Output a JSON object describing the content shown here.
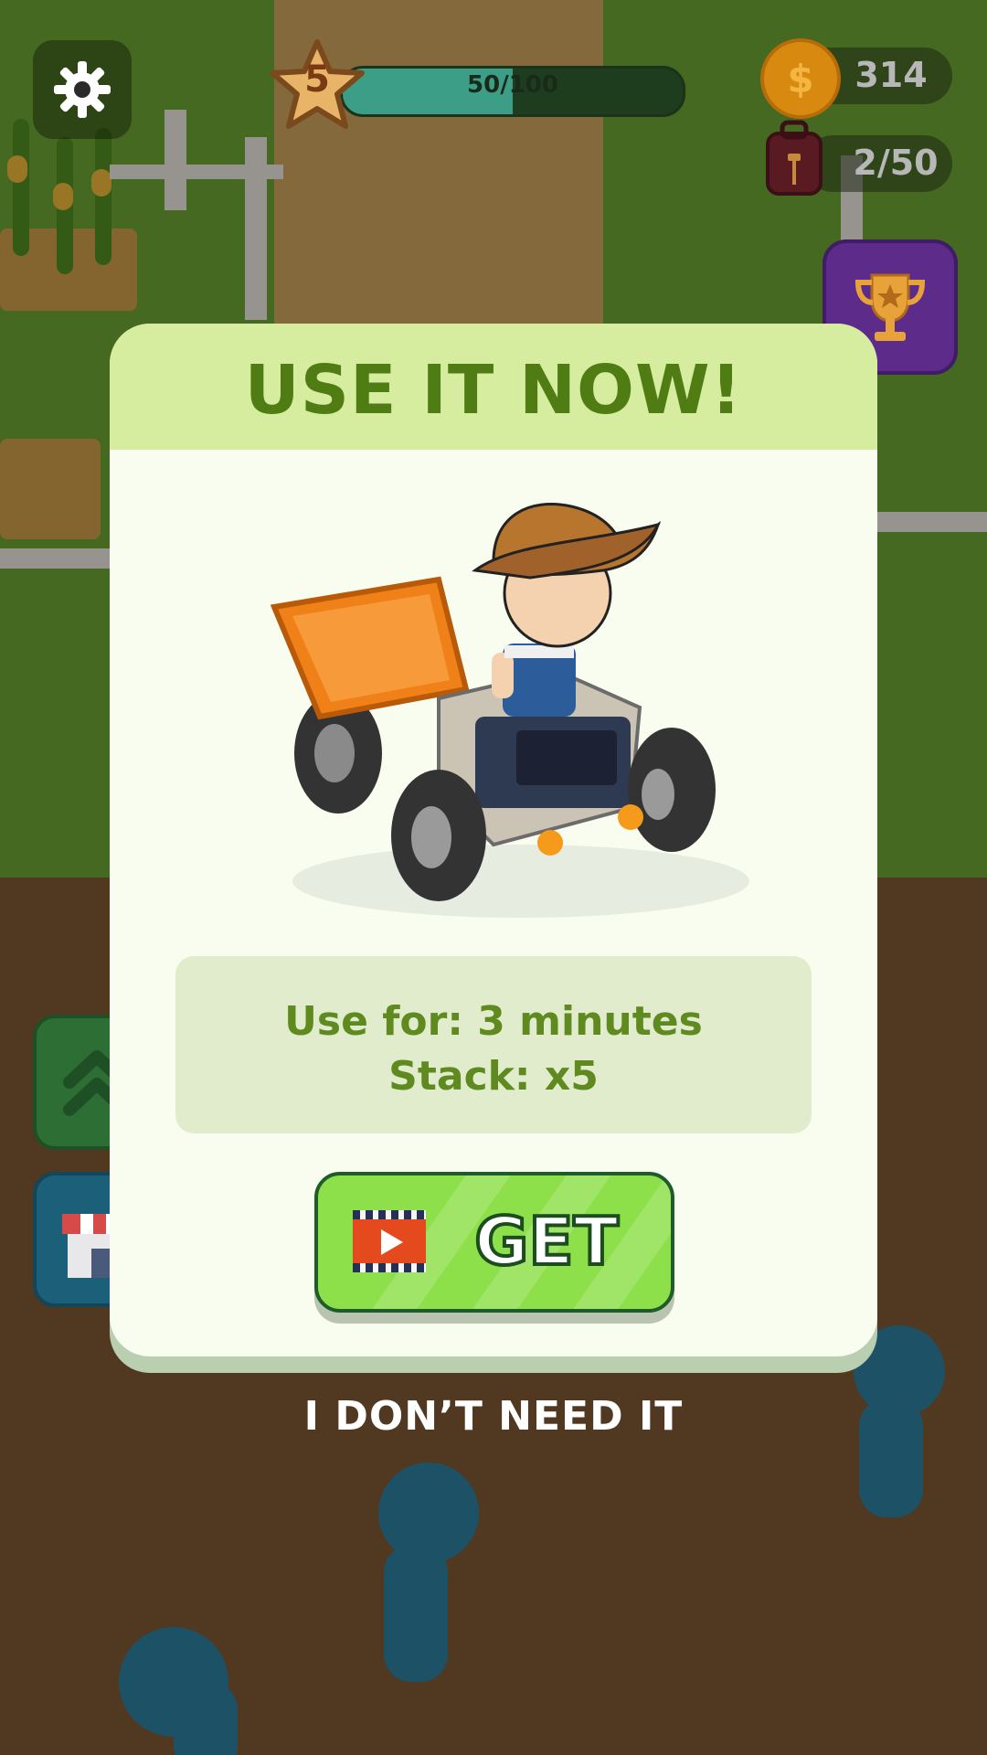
{
  "hud": {
    "level": "5",
    "xp_text": "50/100",
    "xp_progress": 0.5,
    "coins": "314",
    "bag_capacity": "2/50",
    "coin_symbol": "$"
  },
  "modal": {
    "title": "USE IT NOW!",
    "duration_text": "Use for: 3 minutes",
    "stack_text": "Stack: x5",
    "get_label": "GET",
    "decline_label": "I DON’T NEED IT"
  },
  "icons": {
    "settings": "gear-icon",
    "coin": "coin-icon",
    "bag": "backpack-icon",
    "trophy": "trophy-icon",
    "upgrade": "double-chevron-up-icon",
    "shop": "shop-icon",
    "video": "video-ad-icon",
    "vehicle": "farm-tractor-illustration"
  },
  "colors": {
    "title": "#4f7d14",
    "get_button": "#8ee04a",
    "panel": "#f8fdf0"
  }
}
